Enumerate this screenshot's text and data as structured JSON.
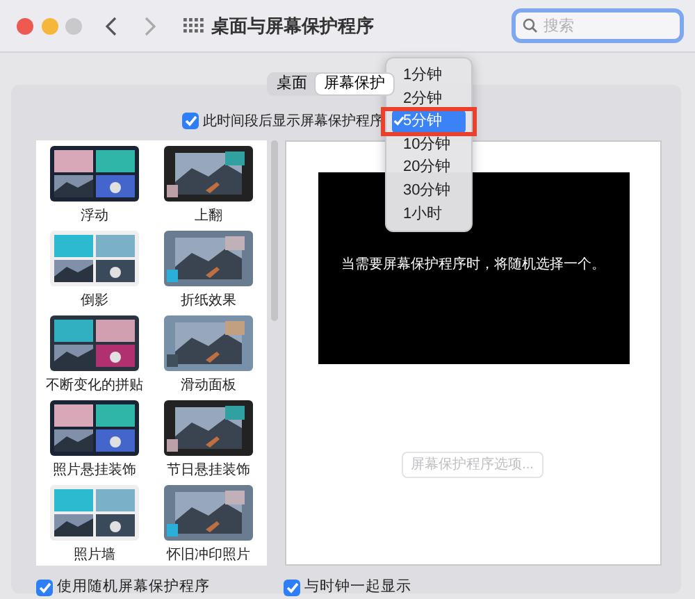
{
  "window": {
    "title": "桌面与屏幕保护程序"
  },
  "search": {
    "placeholder": "搜索"
  },
  "tabs": [
    {
      "label": "桌面",
      "selected": false
    },
    {
      "label": "屏幕保护",
      "selected": true
    }
  ],
  "idle_checkbox": {
    "label": "此时间段后显示屏幕保护程序",
    "checked": true
  },
  "savers": [
    {
      "label": "浮动",
      "selected": false
    },
    {
      "label": "上翻",
      "selected": false
    },
    {
      "label": "倒影",
      "selected": false
    },
    {
      "label": "折纸效果",
      "selected": false
    },
    {
      "label": "不断变化的拼贴",
      "selected": false
    },
    {
      "label": "滑动面板",
      "selected": false
    },
    {
      "label": "照片悬挂装饰",
      "selected": false
    },
    {
      "label": "节日悬挂装饰",
      "selected": false
    },
    {
      "label": "照片墙",
      "selected": false
    },
    {
      "label": "怀旧冲印照片",
      "selected": false
    }
  ],
  "preview": {
    "message": "当需要屏幕保护程序时，将随机选择一个。",
    "options_button": {
      "label": "屏幕保护程序选项...",
      "disabled": true
    }
  },
  "bottom_checkboxes": [
    {
      "label": "使用随机屏幕保护程序",
      "checked": true
    },
    {
      "label": "与时钟一起显示",
      "checked": true
    }
  ],
  "time_menu": [
    {
      "label": "1分钟",
      "selected": false,
      "outlined": false
    },
    {
      "label": "2分钟",
      "selected": false,
      "outlined": false
    },
    {
      "label": "5分钟",
      "selected": true,
      "outlined": true
    },
    {
      "label": "10分钟",
      "selected": false,
      "outlined": false
    },
    {
      "label": "20分钟",
      "selected": false,
      "outlined": false
    },
    {
      "label": "30分钟",
      "selected": false,
      "outlined": false
    },
    {
      "label": "1小时",
      "selected": false,
      "outlined": false
    }
  ]
}
